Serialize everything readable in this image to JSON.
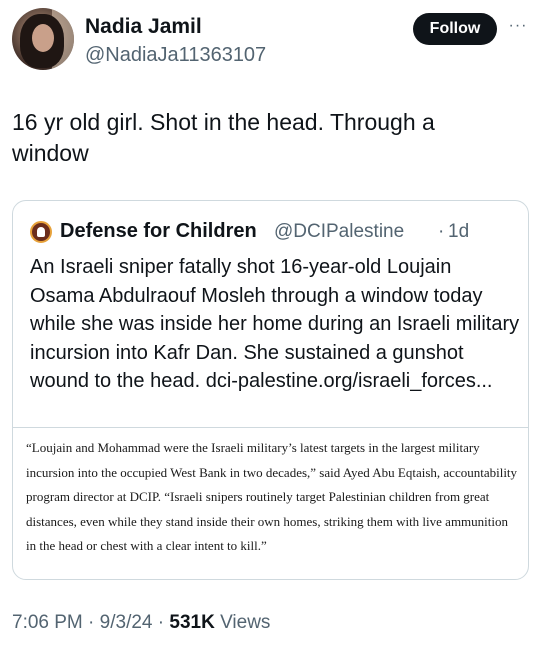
{
  "author": {
    "name": "Nadia Jamil",
    "handle": "@NadiaJa11363107"
  },
  "actions": {
    "follow_label": "Follow",
    "more_label": "···"
  },
  "tweet": {
    "text": "16 yr old girl. Shot in the head. Through a window"
  },
  "quote": {
    "name": "Defense for Children",
    "handle": "@DCIPalestine",
    "separator": "·",
    "time": "1d",
    "text": "An Israeli sniper fatally shot 16-year-old Loujain Osama Abdulraouf Mosleh through a window today while she was inside her home during an Israeli military incursion into Kafr Dan. She sustained a gunshot wound to the head.  dci-palestine.org/israeli_forces...",
    "card_text": "“Loujain and Mohammad were the Israeli military’s latest targets in the largest military incursion into the occupied West Bank in two decades,” said Ayed Abu Eqtaish, accountability program director at DCIP. “Israeli snipers routinely target Palestinian children from great distances, even while they stand inside their own homes, striking them with live ammunition in the head or chest with a clear intent to kill.”"
  },
  "meta": {
    "time": "7:06 PM",
    "dot1": "·",
    "date": "9/3/24",
    "dot2": "·",
    "views_count": "531K",
    "views_label": "Views"
  }
}
